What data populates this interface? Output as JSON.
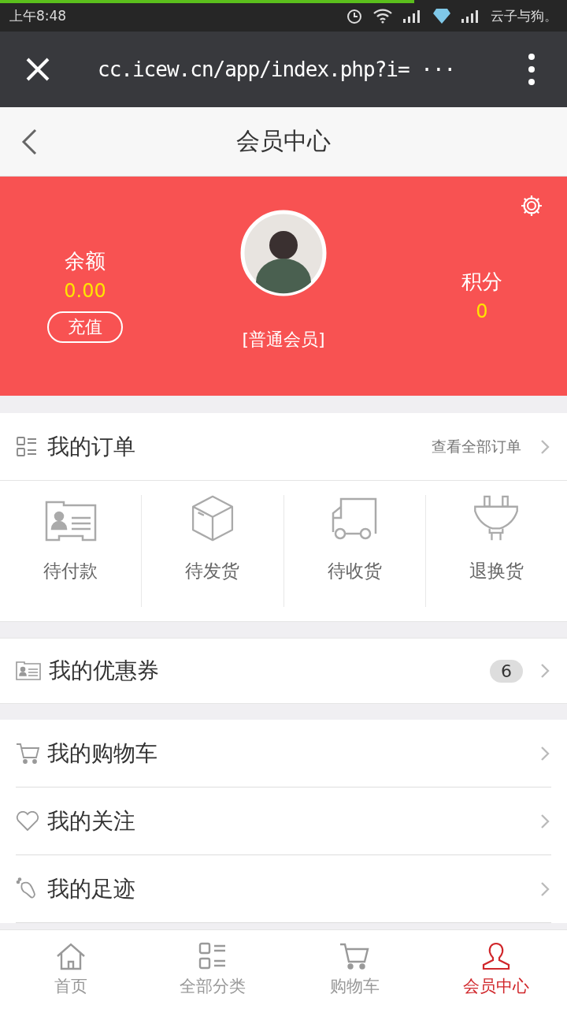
{
  "status_bar": {
    "time": "上午8:48",
    "carrier": "云子与狗。",
    "load_progress": {
      "level": 0.73
    }
  },
  "browser": {
    "url": "cc.icew.cn/app/index.php?i= ···"
  },
  "header": {
    "title": "会员中心"
  },
  "profile": {
    "balance_label": "余额",
    "balance": "0.00",
    "recharge_button": "充值",
    "member_level": "[普通会员]",
    "points_label": "积分",
    "points": "0"
  },
  "orders": {
    "title": "我的订单",
    "view_all": "查看全部订单"
  },
  "order_statuses": [
    {
      "label": "待付款",
      "kind": "card"
    },
    {
      "label": "待发货",
      "kind": "box"
    },
    {
      "label": "待收货",
      "kind": "truck"
    },
    {
      "label": "退换货",
      "kind": "plug"
    }
  ],
  "coupons": {
    "label": "我的优惠券",
    "count": "6"
  },
  "menu": [
    {
      "label": "我的购物车",
      "kind": "cart"
    },
    {
      "label": "我的关注",
      "kind": "heart"
    },
    {
      "label": "我的足迹",
      "kind": "foot"
    }
  ],
  "tabs": [
    {
      "label": "首页",
      "kind": "home",
      "selected": false
    },
    {
      "label": "全部分类",
      "kind": "grid",
      "selected": false
    },
    {
      "label": "购物车",
      "kind": "cart",
      "selected": false
    },
    {
      "label": "会员中心",
      "kind": "user",
      "selected": true
    }
  ]
}
